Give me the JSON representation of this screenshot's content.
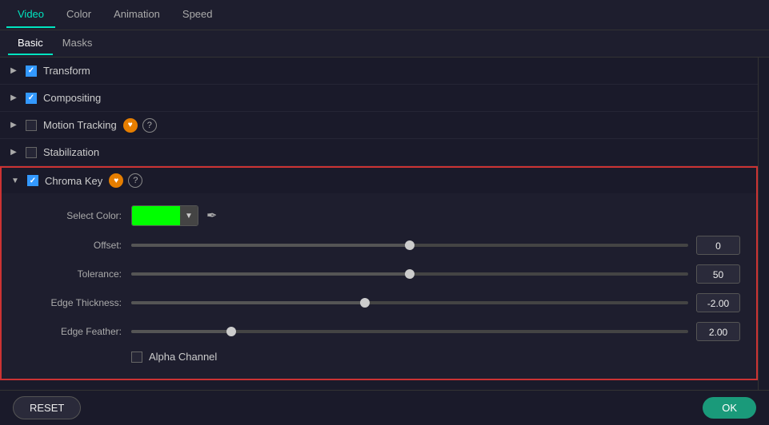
{
  "tabs": {
    "items": [
      {
        "label": "Video",
        "active": true
      },
      {
        "label": "Color",
        "active": false
      },
      {
        "label": "Animation",
        "active": false
      },
      {
        "label": "Speed",
        "active": false
      }
    ]
  },
  "subtabs": {
    "items": [
      {
        "label": "Basic",
        "active": true
      },
      {
        "label": "Masks",
        "active": false
      }
    ]
  },
  "sections": [
    {
      "label": "Transform",
      "checked": true,
      "expanded": false,
      "hasPro": false,
      "hasHelp": false
    },
    {
      "label": "Compositing",
      "checked": true,
      "expanded": false,
      "hasPro": false,
      "hasHelp": false
    },
    {
      "label": "Motion Tracking",
      "checked": false,
      "expanded": false,
      "hasPro": true,
      "hasHelp": true
    },
    {
      "label": "Stabilization",
      "checked": false,
      "expanded": false,
      "hasPro": false,
      "hasHelp": false
    }
  ],
  "chromaKey": {
    "label": "Chroma Key",
    "checked": true,
    "hasPro": true,
    "hasHelp": true,
    "selectColorLabel": "Select Color:",
    "colorValue": "#00ff00",
    "dropperTitle": "eyedropper",
    "controls": [
      {
        "label": "Offset:",
        "value": "0",
        "fillPercent": 50
      },
      {
        "label": "Tolerance:",
        "value": "50",
        "fillPercent": 50
      },
      {
        "label": "Edge Thickness:",
        "value": "-2.00",
        "fillPercent": 42
      },
      {
        "label": "Edge Feather:",
        "value": "2.00",
        "fillPercent": 18
      }
    ],
    "alphaChannelLabel": "Alpha Channel"
  },
  "bottomBar": {
    "resetLabel": "RESET",
    "okLabel": "OK"
  },
  "icons": {
    "arrowRight": "▶",
    "arrowDown": "▼",
    "dropdownArrow": "▼",
    "eyedropper": "✒",
    "proIcon": "♥",
    "helpIcon": "?"
  }
}
